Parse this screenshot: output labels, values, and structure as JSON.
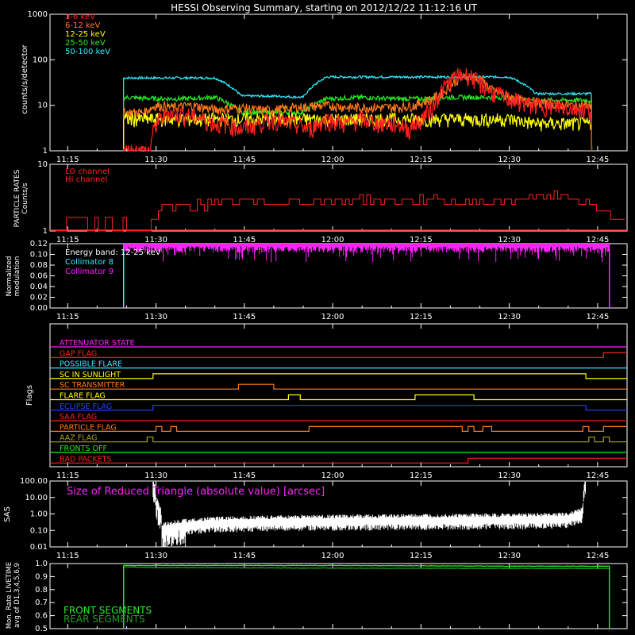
{
  "title": "HESSI Observing Summary, starting on 2012/12/22 11:12:16 UT",
  "colors": {
    "bg": "#000000",
    "axis": "#ffffff",
    "red": "#ff2020",
    "orange": "#ff7a1a",
    "yellow": "#ffff00",
    "green": "#22ee22",
    "cyan": "#33eeff",
    "magenta": "#ff22ff",
    "blue": "#2244ff",
    "olive": "#a8a020",
    "darkgreen": "#1ea01e"
  },
  "time_ticks": [
    "11:15",
    "11:30",
    "11:45",
    "12:00",
    "12:15",
    "12:30",
    "12:45"
  ],
  "chart_data": [
    {
      "type": "line",
      "panel": "count-rates",
      "ylabel": "counts/s/detector",
      "yscale": "log",
      "ylim": [
        1,
        1000
      ],
      "yticks": [
        "1",
        "10",
        "100",
        "1000"
      ],
      "xlim": [
        "11:12",
        "12:50"
      ],
      "legend_position": "top-left",
      "series": [
        {
          "name": "3-6 keV",
          "color": "red",
          "x": [
            "11:24.5",
            "11:29",
            "11:30",
            "11:32",
            "11:36",
            "11:40",
            "11:42",
            "11:44.5",
            "11:47",
            "11:50",
            "11:53",
            "11:56",
            "11:59",
            "12:02",
            "12:05",
            "12:08",
            "12:11",
            "12:13",
            "12:15",
            "12:17",
            "12:19",
            "12:21",
            "12:23",
            "12:25",
            "12:27",
            "12:30",
            "12:33",
            "12:36",
            "12:40",
            "12:44"
          ],
          "y": [
            1,
            1,
            4,
            7,
            6,
            4,
            4,
            3,
            4,
            5,
            4,
            3,
            5,
            4,
            5,
            4,
            4,
            3,
            5,
            9,
            25,
            45,
            48,
            30,
            20,
            14,
            11,
            10,
            9,
            8
          ]
        },
        {
          "name": "6-12 keV",
          "color": "orange",
          "x": [
            "11:24.5",
            "11:28",
            "11:30",
            "11:33",
            "11:36",
            "11:40",
            "11:44.5",
            "11:47",
            "11:50",
            "11:54",
            "11:59",
            "12:03",
            "12:07",
            "12:11",
            "12:14",
            "12:17",
            "12:19",
            "12:21",
            "12:23",
            "12:25",
            "12:27",
            "12:30",
            "12:33",
            "12:36",
            "12:40",
            "12:44"
          ],
          "y": [
            7,
            7,
            10,
            9,
            10,
            8,
            9,
            8,
            8,
            9,
            10,
            9,
            9,
            9,
            10,
            14,
            20,
            35,
            45,
            38,
            22,
            15,
            12,
            11,
            10,
            10
          ]
        },
        {
          "name": "12-25 keV",
          "color": "yellow",
          "x": [
            "11:24.5",
            "11:30",
            "11:35",
            "11:40",
            "11:44.5",
            "11:50",
            "11:55",
            "11:59",
            "12:05",
            "12:10",
            "12:15",
            "12:20",
            "12:25",
            "12:30",
            "12:34.5",
            "12:40",
            "12:44"
          ],
          "y": [
            5,
            5,
            5,
            5,
            5,
            5,
            5,
            5,
            5,
            5,
            5,
            5,
            5,
            5,
            4,
            4,
            4
          ]
        },
        {
          "name": "25-50 keV",
          "color": "green",
          "x": [
            "11:24.5",
            "11:30",
            "11:35",
            "11:40",
            "11:44.5",
            "11:50",
            "11:55",
            "11:59",
            "12:05",
            "12:10",
            "12:15",
            "12:20",
            "12:25",
            "12:30",
            "12:34.5",
            "12:40",
            "12:44"
          ],
          "y": [
            15,
            14,
            14,
            15,
            7,
            7,
            7,
            14,
            15,
            14,
            14,
            15,
            15,
            15,
            13,
            13,
            13
          ]
        },
        {
          "name": "50-100 keV",
          "color": "cyan",
          "x": [
            "11:24.5",
            "11:30",
            "11:35",
            "11:40",
            "11:44.5",
            "11:50",
            "11:55",
            "11:59",
            "12:05",
            "12:10",
            "12:15",
            "12:20",
            "12:25",
            "12:30",
            "12:34.5",
            "12:40",
            "12:44"
          ],
          "y": [
            40,
            40,
            40,
            40,
            16,
            16,
            15,
            42,
            42,
            42,
            42,
            42,
            42,
            42,
            18,
            18,
            18
          ]
        }
      ]
    },
    {
      "type": "line",
      "panel": "particle-rates",
      "ylabel": "PARTICLE RATES Counts/s",
      "yscale": "log",
      "ylim": [
        1,
        10
      ],
      "yticks": [
        "1",
        "10"
      ],
      "legend_position": "top-left",
      "series": [
        {
          "name": "LO channel",
          "color": "red",
          "x": [
            "11:13",
            "11:28",
            "11:29",
            "11:31",
            "11:35",
            "11:40",
            "11:45",
            "11:50",
            "11:55",
            "12:00",
            "12:05",
            "12:10",
            "12:15",
            "12:20",
            "12:25",
            "12:30",
            "12:35",
            "12:40",
            "12:43",
            "12:45",
            "12:48"
          ],
          "y": [
            1,
            1,
            1.5,
            2,
            2.5,
            2.5,
            2.8,
            2.5,
            2.8,
            2.8,
            3,
            2.7,
            3,
            2.7,
            2.7,
            2.9,
            3.2,
            3.5,
            2.5,
            2,
            1.5
          ]
        },
        {
          "name": "HI channel",
          "color": "red",
          "x": [
            "11:13",
            "12:50"
          ],
          "y": [
            1,
            1
          ]
        }
      ]
    },
    {
      "type": "line",
      "panel": "modulation",
      "ylabel": "Normalized modulation",
      "ylim": [
        0,
        0.12
      ],
      "yticks": [
        "0.00",
        "0.02",
        "0.04",
        "0.06",
        "0.08",
        "0.10",
        "0.12"
      ],
      "annotation": "Energy band: 12-25 keV",
      "legend_position": "top-left",
      "series": [
        {
          "name": "Collimator 8",
          "color": "cyan",
          "x": [
            "11:24.5",
            "12:47"
          ],
          "y": [
            0.12,
            0.12
          ]
        },
        {
          "name": "Collimator 9",
          "color": "magenta",
          "x": [
            "11:24.5",
            "12:47"
          ],
          "y": [
            0.11,
            0.11
          ]
        }
      ]
    },
    {
      "type": "line",
      "panel": "flags",
      "ylabel": "Flags",
      "series": [
        {
          "name": "ATTENUATOR STATE",
          "color": "magenta",
          "transitions": []
        },
        {
          "name": "GAP FLAG",
          "color": "red",
          "transitions": [
            "12:46"
          ]
        },
        {
          "name": "POSSIBLE FLARE",
          "color": "cyan",
          "transitions": []
        },
        {
          "name": "SC IN SUNLIGHT",
          "color": "yellow",
          "transitions": [
            "11:29.5",
            "12:43"
          ]
        },
        {
          "name": "SC TRANSMITTER",
          "color": "orange",
          "transitions": [
            "11:44",
            "11:50"
          ]
        },
        {
          "name": "FLARE FLAG",
          "color": "yellow",
          "transitions": [
            "11:52.5",
            "11:54.5",
            "12:14",
            "12:24"
          ]
        },
        {
          "name": "ECLIPSE FLAG",
          "color": "blue",
          "transitions": [
            "11:29.5",
            "12:43"
          ]
        },
        {
          "name": "SAA FLAG",
          "color": "red",
          "transitions": []
        },
        {
          "name": "PARTICLE FLAG",
          "color": "orange",
          "transitions": [
            "11:30",
            "11:31",
            "11:32.5",
            "11:33.5",
            "11:56",
            "12:22",
            "12:23",
            "12:24",
            "12:25.5",
            "12:27",
            "12:42.5",
            "12:43.5",
            "12:46"
          ]
        },
        {
          "name": "AAZ FLAG",
          "color": "olive",
          "transitions": [
            "11:28.5",
            "11:29.5",
            "12:43.5",
            "12:44.5",
            "12:46",
            "12:47"
          ]
        },
        {
          "name": "FRONTS OFF",
          "color": "green",
          "transitions": []
        },
        {
          "name": "BAD PACKETS",
          "color": "red",
          "transitions": [
            "12:23"
          ]
        }
      ]
    },
    {
      "type": "line",
      "panel": "sas",
      "ylabel": "SAS",
      "yscale": "log",
      "ylim": [
        0.01,
        100
      ],
      "yticks": [
        "0.01",
        "0.10",
        "1.00",
        "10.00",
        "100.00"
      ],
      "annotation": "Size of Reduced Triangle (absolute value) [arcsec]",
      "series": [
        {
          "name": "Size of Reduced Triangle",
          "color": "white",
          "x": [
            "11:29.5",
            "11:30",
            "11:31",
            "11:33",
            "11:36",
            "11:40",
            "11:45",
            "11:50",
            "11:55",
            "12:00",
            "12:10",
            "12:20",
            "12:30",
            "12:40",
            "12:42.5",
            "12:43"
          ],
          "y": [
            60,
            4,
            0.1,
            0.15,
            0.2,
            0.25,
            0.28,
            0.3,
            0.32,
            0.33,
            0.35,
            0.37,
            0.4,
            0.45,
            1,
            60
          ]
        }
      ]
    },
    {
      "type": "line",
      "panel": "livetime",
      "ylabel": "Mon. Rate LIVETIME avg of D1,3,4,5,6,9",
      "ylim": [
        0.5,
        1.0
      ],
      "yticks": [
        "0.5",
        "0.6",
        "0.7",
        "0.8",
        "0.9",
        "1.0"
      ],
      "legend_position": "bottom-left",
      "series": [
        {
          "name": "FRONT SEGMENTS",
          "color": "green",
          "x": [
            "11:24.5",
            "11:30",
            "12:00",
            "12:30",
            "12:47"
          ],
          "y": [
            0.985,
            0.985,
            0.985,
            0.98,
            0.98
          ]
        },
        {
          "name": "REAR SEGMENTS",
          "color": "darkgreen",
          "x": [
            "11:24.5",
            "11:30",
            "12:00",
            "12:30",
            "12:47"
          ],
          "y": [
            0.975,
            0.97,
            0.965,
            0.962,
            0.962
          ]
        }
      ]
    }
  ]
}
